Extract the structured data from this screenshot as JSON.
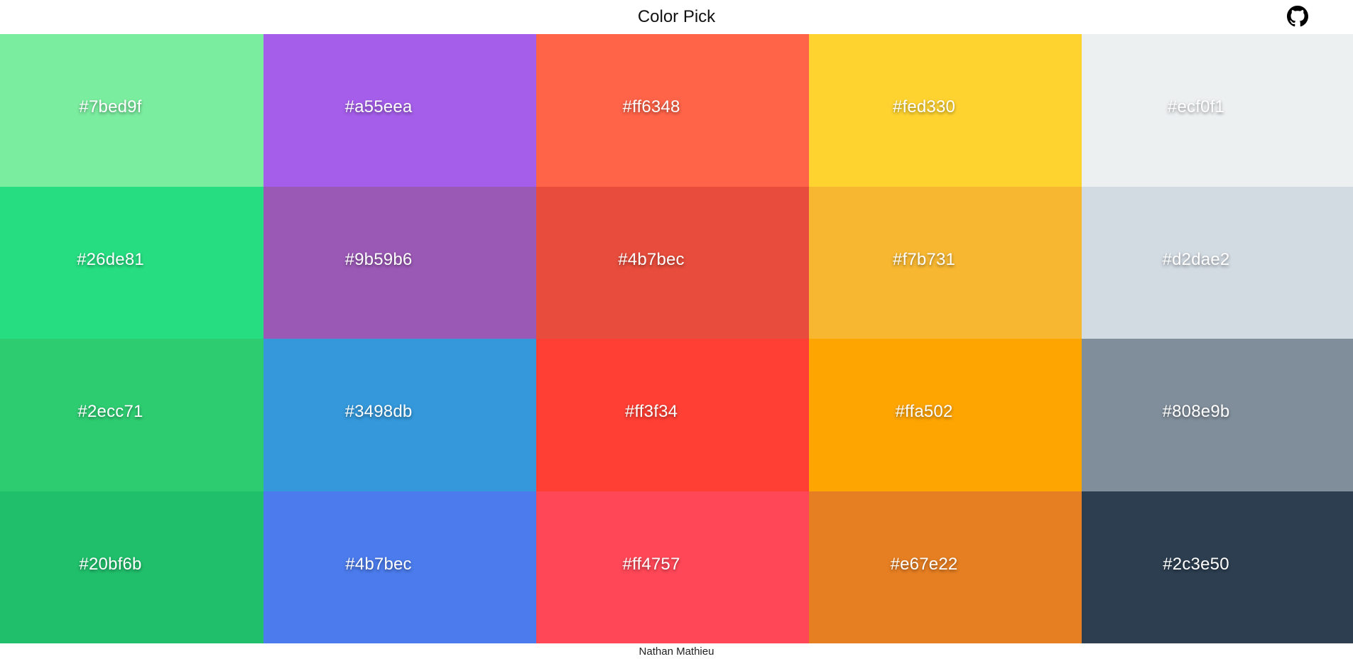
{
  "header": {
    "title": "Color Pick",
    "github_icon": "github-icon"
  },
  "palette": {
    "rows": [
      [
        {
          "hex": "#7bed9f",
          "color": "#7bed9f"
        },
        {
          "hex": "#a55eea",
          "color": "#a55eea"
        },
        {
          "hex": "#ff6348",
          "color": "#ff6348"
        },
        {
          "hex": "#fed330",
          "color": "#fed330"
        },
        {
          "hex": "#ecf0f1",
          "color": "#ecf0f1"
        }
      ],
      [
        {
          "hex": "#26de81",
          "color": "#26de81"
        },
        {
          "hex": "#9b59b6",
          "color": "#9b59b6"
        },
        {
          "hex": "#4b7bec",
          "color": "#e74c3c"
        },
        {
          "hex": "#f7b731",
          "color": "#f7b731"
        },
        {
          "hex": "#d2dae2",
          "color": "#d2dae2"
        }
      ],
      [
        {
          "hex": "#2ecc71",
          "color": "#2ecc71"
        },
        {
          "hex": "#3498db",
          "color": "#3498db"
        },
        {
          "hex": "#ff3f34",
          "color": "#ff3f34"
        },
        {
          "hex": "#ffa502",
          "color": "#ffa502"
        },
        {
          "hex": "#808e9b",
          "color": "#808e9b"
        }
      ],
      [
        {
          "hex": "#20bf6b",
          "color": "#20bf6b"
        },
        {
          "hex": "#4b7bec",
          "color": "#4b7bec"
        },
        {
          "hex": "#ff4757",
          "color": "#ff4757"
        },
        {
          "hex": "#e67e22",
          "color": "#e67e22"
        },
        {
          "hex": "#2c3e50",
          "color": "#2c3e50"
        }
      ]
    ]
  },
  "footer": {
    "author": "Nathan Mathieu"
  }
}
